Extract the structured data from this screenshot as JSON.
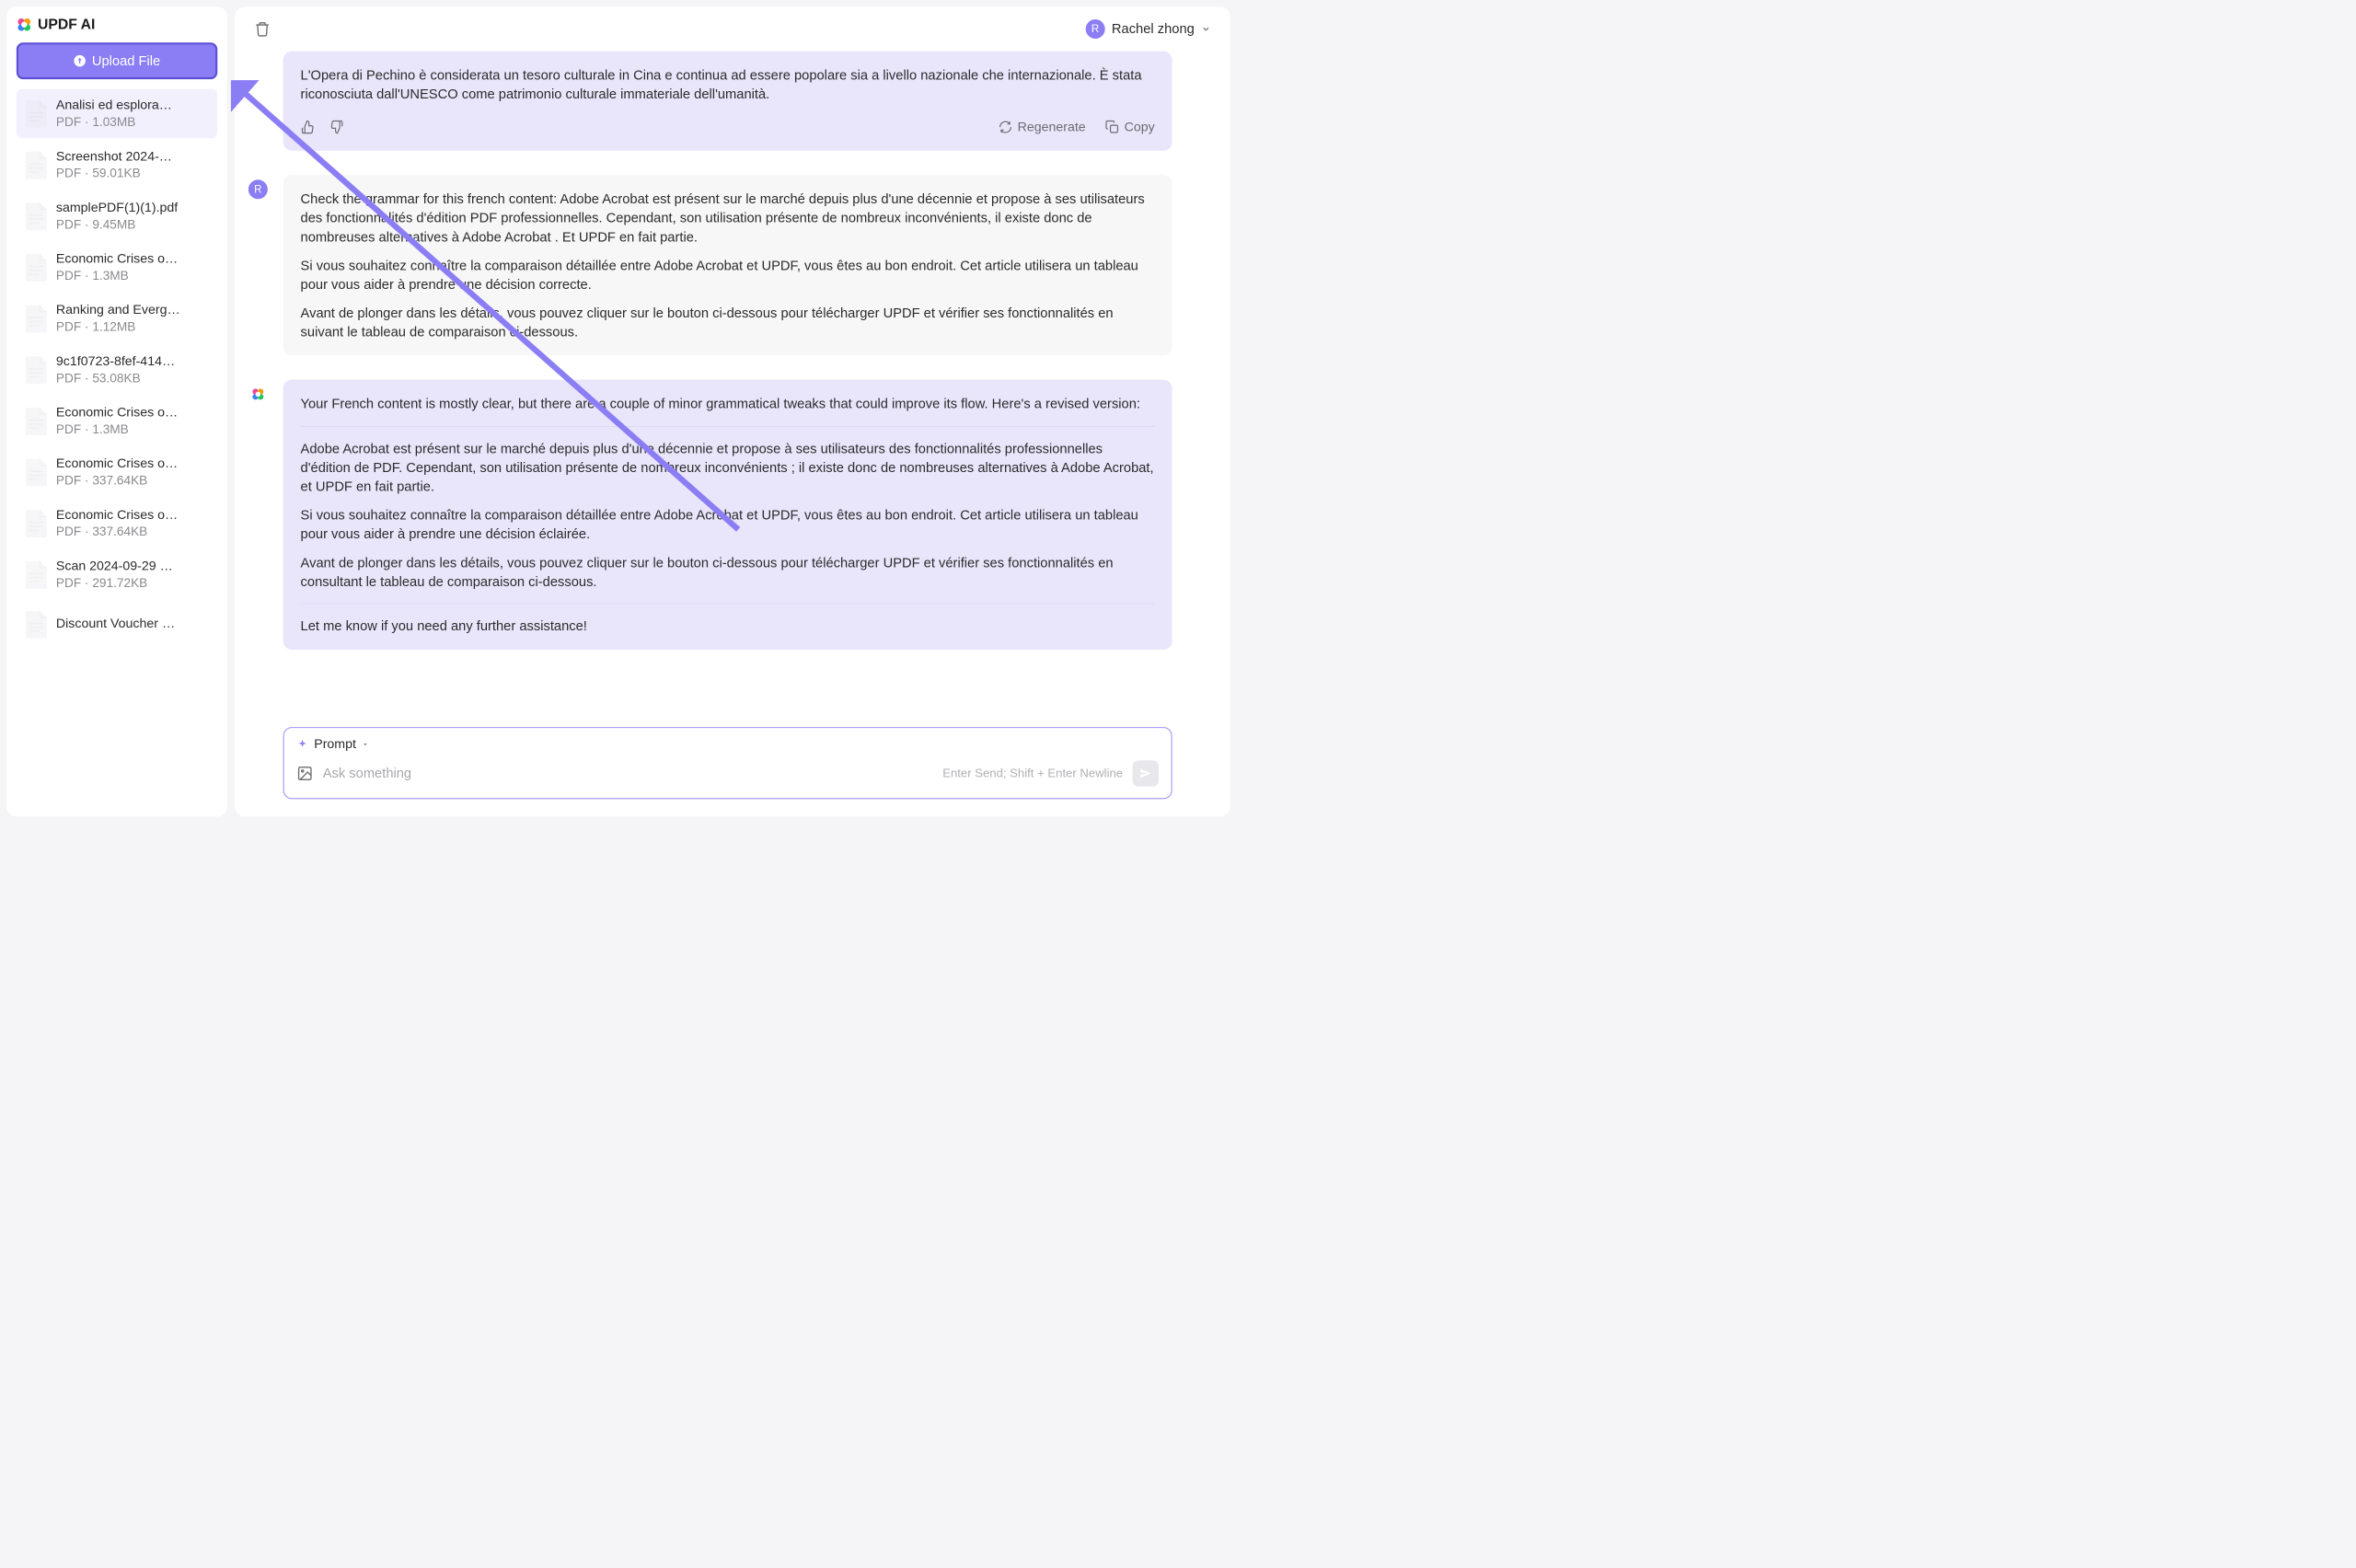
{
  "sidebar": {
    "app_title": "UPDF AI",
    "upload_label": "Upload File",
    "files": [
      {
        "name": "Analisi ed esplora…",
        "meta": "PDF · 1.03MB",
        "active": true
      },
      {
        "name": "Screenshot 2024-…",
        "meta": "PDF · 59.01KB",
        "active": false
      },
      {
        "name": "samplePDF(1)(1).pdf",
        "meta": "PDF · 9.45MB",
        "active": false
      },
      {
        "name": "Economic Crises o…",
        "meta": "PDF · 1.3MB",
        "active": false
      },
      {
        "name": "Ranking and Everg…",
        "meta": "PDF · 1.12MB",
        "active": false
      },
      {
        "name": "9c1f0723-8fef-414…",
        "meta": "PDF · 53.08KB",
        "active": false
      },
      {
        "name": "Economic Crises o…",
        "meta": "PDF · 1.3MB",
        "active": false
      },
      {
        "name": "Economic Crises o…",
        "meta": "PDF · 337.64KB",
        "active": false
      },
      {
        "name": "Economic Crises o…",
        "meta": "PDF · 337.64KB",
        "active": false
      },
      {
        "name": "Scan 2024-09-29 …",
        "meta": "PDF · 291.72KB",
        "active": false
      },
      {
        "name": "Discount Voucher …",
        "meta": "",
        "active": false
      }
    ]
  },
  "header": {
    "user_name": "Rachel zhong",
    "avatar_letter": "R"
  },
  "chat": {
    "msg1": {
      "text": "L'Opera di Pechino è considerata un tesoro culturale in Cina e continua ad essere popolare sia a livello nazionale che internazionale. È stata riconosciuta dall'UNESCO come patrimonio culturale immateriale dell'umanità.",
      "regenerate": "Regenerate",
      "copy": "Copy"
    },
    "msg2": {
      "avatar_letter": "R",
      "p1": "Check the grammar for this french content: Adobe Acrobat est présent sur le marché depuis plus d'une décennie et propose à ses utilisateurs des fonctionnalités d'édition PDF professionnelles. Cependant, son utilisation présente de nombreux inconvénients, il existe donc de nombreuses alternatives à Adobe Acrobat . Et UPDF en fait partie.",
      "p2": "Si vous souhaitez connaître la comparaison détaillée entre Adobe Acrobat et UPDF, vous êtes au bon endroit. Cet article utilisera un tableau pour vous aider à prendre une décision correcte.",
      "p3": "Avant de plonger dans les détails, vous pouvez cliquer sur le bouton ci-dessous pour télécharger UPDF et vérifier ses fonctionnalités en suivant le tableau de comparaison ci-dessous."
    },
    "msg3": {
      "intro": "Your French content is mostly clear, but there are a couple of minor grammatical tweaks that could improve its flow. Here's a revised version:",
      "p1": "Adobe Acrobat est présent sur le marché depuis plus d'une décennie et propose à ses utilisateurs des fonctionnalités professionnelles d'édition de PDF. Cependant, son utilisation présente de nombreux inconvénients ; il existe donc de nombreuses alternatives à Adobe Acrobat, et UPDF en fait partie.",
      "p2": "Si vous souhaitez connaître la comparaison détaillée entre Adobe Acrobat et UPDF, vous êtes au bon endroit. Cet article utilisera un tableau pour vous aider à prendre une décision éclairée.",
      "p3": "Avant de plonger dans les détails, vous pouvez cliquer sur le bouton ci-dessous pour télécharger UPDF et vérifier ses fonctionnalités en consultant le tableau de comparaison ci-dessous.",
      "closing": "Let me know if you need any further assistance!"
    }
  },
  "input": {
    "prompt_label": "Prompt",
    "placeholder": "Ask something",
    "hint": "Enter Send; Shift + Enter Newline"
  }
}
